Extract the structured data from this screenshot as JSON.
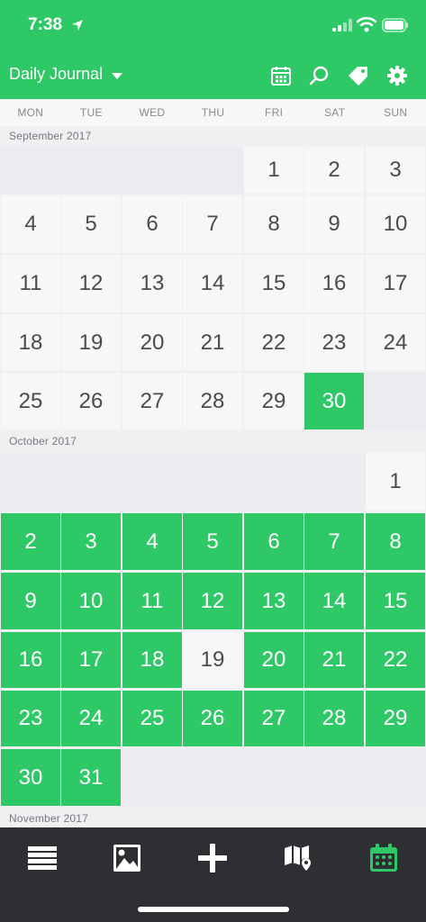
{
  "status": {
    "time": "7:38"
  },
  "header": {
    "title": "Daily Journal"
  },
  "weekdays": [
    "MON",
    "TUE",
    "WED",
    "THU",
    "FRI",
    "SAT",
    "SUN"
  ],
  "months": {
    "sep": {
      "label": "September 2017"
    },
    "oct": {
      "label": "October 2017"
    },
    "nov": {
      "label": "November 2017"
    }
  },
  "days": {
    "sep": [
      "1",
      "2",
      "3",
      "4",
      "5",
      "6",
      "7",
      "8",
      "9",
      "10",
      "11",
      "12",
      "13",
      "14",
      "15",
      "16",
      "17",
      "18",
      "19",
      "20",
      "21",
      "22",
      "23",
      "24",
      "25",
      "26",
      "27",
      "28",
      "29",
      "30"
    ],
    "oct": [
      "1",
      "2",
      "3",
      "4",
      "5",
      "6",
      "7",
      "8",
      "9",
      "10",
      "11",
      "12",
      "13",
      "14",
      "15",
      "16",
      "17",
      "18",
      "19",
      "20",
      "21",
      "22",
      "23",
      "24",
      "25",
      "26",
      "27",
      "28",
      "29",
      "30",
      "31"
    ]
  },
  "entries": {
    "sep": [
      30
    ],
    "oct": [
      2,
      3,
      4,
      5,
      6,
      7,
      8,
      9,
      10,
      11,
      12,
      13,
      14,
      15,
      16,
      17,
      18,
      20,
      21,
      22,
      23,
      24,
      25,
      26,
      27,
      28,
      29,
      30,
      31
    ]
  },
  "tabs": [
    "list-icon",
    "photo-icon",
    "add-icon",
    "map-icon",
    "calendar-icon"
  ],
  "colors": {
    "accent": "#2ec866",
    "bar": "#2d2f33",
    "cell": "#f7f7f8",
    "empty": "#ececf0"
  }
}
